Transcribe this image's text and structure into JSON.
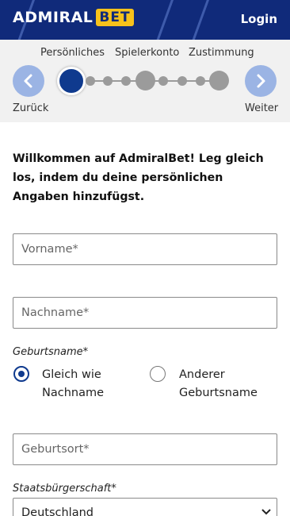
{
  "header": {
    "logo_word": "ADMIRAL",
    "logo_bet": "BET",
    "login_label": "Login",
    "brand_color": "#102a7a",
    "accent_color": "#f7c21b"
  },
  "stepper": {
    "steps": [
      "Persönliches",
      "Spielerkonto",
      "Zustimmung"
    ],
    "back_label": "Zurück",
    "next_label": "Weiter",
    "current_step": 1,
    "total_steps": 3,
    "active_color": "#0f3a8e"
  },
  "form": {
    "intro": "Willkommen auf AdmiralBet! Leg gleich los, indem du deine persönlichen Angaben hinzufügst.",
    "firstname_placeholder": "Vorname*",
    "lastname_placeholder": "Nachname*",
    "birthname_label": "Geburtsname*",
    "birthname_options": [
      {
        "label": "Gleich wie Nachname",
        "selected": true
      },
      {
        "label": "Anderer Geburtsname",
        "selected": false
      }
    ],
    "birthplace_placeholder": "Geburtsort*",
    "citizenship_label": "Staatsbürgerschaft*",
    "citizenship_value": "Deutschland"
  }
}
